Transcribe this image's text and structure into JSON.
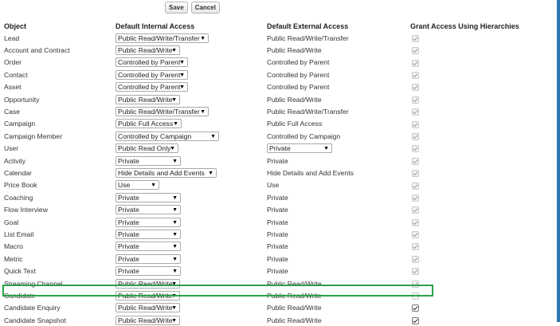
{
  "toolbar": {
    "save_label": "Save",
    "cancel_label": "Cancel"
  },
  "table": {
    "headers": [
      "Object",
      "Default Internal Access",
      "Default External Access",
      "Grant Access Using Hierarchies"
    ],
    "rows": [
      {
        "object": "Lead",
        "internal": "Public Read/Write/Transfer",
        "internal_w": 1,
        "external": "Public Read/Write/Transfer",
        "external_select": false,
        "grant": "checked-disabled"
      },
      {
        "object": "Account and Contract",
        "internal": "Public Read/Write",
        "external": "Public Read/Write",
        "external_select": false,
        "grant": "checked-disabled"
      },
      {
        "object": "Order",
        "internal": "Controlled by Parent",
        "external": "Controlled by Parent",
        "external_select": false,
        "grant": "checked-disabled"
      },
      {
        "object": "Contact",
        "internal": "Controlled by Parent",
        "external": "Controlled by Parent",
        "external_select": false,
        "grant": "checked-disabled"
      },
      {
        "object": "Asset",
        "internal": "Controlled by Parent",
        "external": "Controlled by Parent",
        "external_select": false,
        "grant": "checked-disabled"
      },
      {
        "object": "Opportunity",
        "internal": "Public Read/Write",
        "external": "Public Read/Write",
        "external_select": false,
        "grant": "checked-disabled"
      },
      {
        "object": "Case",
        "internal": "Public Read/Write/Transfer",
        "external": "Public Read/Write/Transfer",
        "external_select": false,
        "grant": "checked-disabled"
      },
      {
        "object": "Campaign",
        "internal": "Public Full Access",
        "external": "Public Full Access",
        "external_select": false,
        "grant": "checked-disabled"
      },
      {
        "object": "Campaign Member",
        "internal": "Controlled by Campaign",
        "external": "Controlled by Campaign",
        "external_select": false,
        "grant": "checked-disabled"
      },
      {
        "object": "User",
        "internal": "Public Read Only",
        "external": "Private",
        "external_select": true,
        "grant": "checked-disabled"
      },
      {
        "object": "Activity",
        "internal": "Private",
        "external": "Private",
        "external_select": false,
        "grant": "checked-disabled"
      },
      {
        "object": "Calendar",
        "internal": "Hide Details and Add Events",
        "external": "Hide Details and Add Events",
        "external_select": false,
        "grant": "checked-disabled"
      },
      {
        "object": "Price Book",
        "internal": "Use",
        "external": "Use",
        "external_select": false,
        "grant": "checked-disabled"
      },
      {
        "object": "Coaching",
        "internal": "Private",
        "external": "Private",
        "external_select": false,
        "grant": "checked-disabled"
      },
      {
        "object": "Flow Interview",
        "internal": "Private",
        "external": "Private",
        "external_select": false,
        "grant": "checked-disabled"
      },
      {
        "object": "Goal",
        "internal": "Private",
        "external": "Private",
        "external_select": false,
        "grant": "checked-disabled"
      },
      {
        "object": "List Email",
        "internal": "Private",
        "external": "Private",
        "external_select": false,
        "grant": "checked-disabled"
      },
      {
        "object": "Macro",
        "internal": "Private",
        "external": "Private",
        "external_select": false,
        "grant": "checked-disabled"
      },
      {
        "object": "Metric",
        "internal": "Private",
        "external": "Private",
        "external_select": false,
        "grant": "checked-disabled"
      },
      {
        "object": "Quick Text",
        "internal": "Private",
        "external": "Private",
        "external_select": false,
        "grant": "checked-disabled"
      },
      {
        "object": "Streaming Channel",
        "internal": "Public Read/Write",
        "external": "Public Read/Write",
        "external_select": false,
        "grant": "checked-disabled"
      },
      {
        "object": "Candidate",
        "internal": "Public Read/Write",
        "external": "Public Read/Write",
        "external_select": false,
        "grant": "unchecked"
      },
      {
        "object": "Candidate Enquiry",
        "internal": "Public Read/Write",
        "external": "Public Read/Write",
        "external_select": false,
        "grant": "checked-enabled"
      },
      {
        "object": "Candidate Snapshot",
        "internal": "Public Read/Write",
        "external": "Public Read/Write",
        "external_select": false,
        "grant": "checked-enabled"
      }
    ]
  },
  "colors": {
    "highlight": "#2aa14a",
    "edge": "#2a7ab0"
  }
}
